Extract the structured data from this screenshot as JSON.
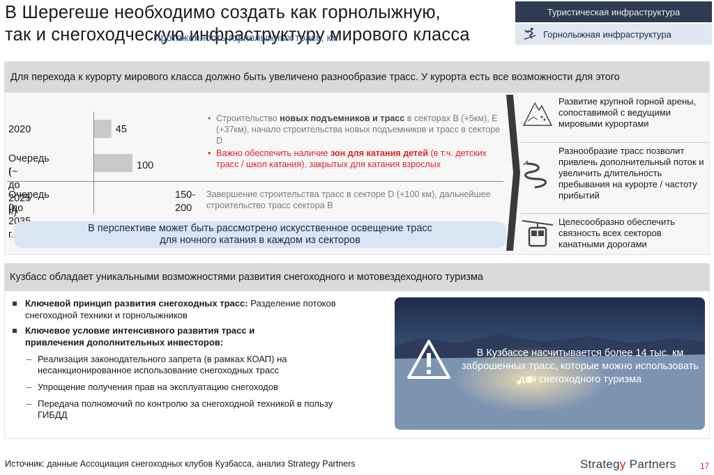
{
  "title": {
    "line1": "В Шерегеше необходимо создать как горнолыжную,",
    "line2": "так и снегоходческую инфраструктуру мирового класса"
  },
  "category": {
    "top": "Туристическая инфраструктура",
    "sub": "Горнолыжная инфраструктура",
    "sub_icon": "skier-icon"
  },
  "panel1": {
    "header": "Для перехода к курорту мирового класса должно быть увеличено разнообразие трасс. У курорта есть все возможности для этого",
    "chart_title": "Протяженность горнолыжных трасс,",
    "chart_unit": " км",
    "bullets_top": [
      {
        "pre": "Строительство ",
        "bold": "новых подъемников и трасс",
        "post": " в секторах В (+5км), Е (+37км), начало строительства новых подъемников и трасс в секторе D",
        "red": false
      },
      {
        "pre": "Важно обеспечить наличие ",
        "bold": "зон для катания детей",
        "post": " (в т.ч. детских трасс / школ катания), закрытых для катания взрослых",
        "red": true
      }
    ],
    "bullet_bottom": "Завершение строительства трасс в секторе D (+100 км), дальнейшее строительство трасс сектора В",
    "perspective": {
      "line1": "В перспективе может быть рассмотрено искусственное освещение трасс",
      "line2": "для ночного катания в каждом из секторов"
    },
    "right_items": [
      {
        "icon": "mountain-icon",
        "text": "Развитие крупной горной арены, сопоставимой с ведущими мировыми курортами"
      },
      {
        "icon": "winding-trail-icon",
        "text": "Разнообразие трасс позволит привлечь дополнительный поток и увеличить длительность пребывания на курорте / частоту прибытий"
      },
      {
        "icon": "cable-car-icon",
        "text": "Целесообразно обеспечить связность всех секторов канатными дорогами"
      }
    ]
  },
  "chart_data": {
    "type": "bar",
    "orientation": "horizontal",
    "title": "Протяженность горнолыжных трасс, км",
    "categories": [
      "2020",
      "Очередь I (~ до 2025 г.)",
      "Очередь II (до 2035 г.)"
    ],
    "category_lines": [
      [
        "2020"
      ],
      [
        "Очередь I",
        "(~ до 2025 г.)"
      ],
      [
        "Очередь II",
        "(до 2035 г.)"
      ]
    ],
    "values": [
      45,
      100,
      200
    ],
    "value_labels": [
      [
        "45"
      ],
      [
        "100"
      ],
      [
        "150-",
        "200"
      ]
    ],
    "xlim": [
      0,
      200
    ],
    "color": "#c9c9c9",
    "grid": false,
    "legend": "none"
  },
  "panel2": {
    "header": "Кузбасс обладает уникальными возможностями развития снегоходного и мотовездеходного туризма",
    "key1_bold": "Ключевой принцип развития снегоходных трасс:",
    "key1_rest": " Разделение потоков снегоходной техники и горнолыжников",
    "key2_bold": "Ключевое условие интенсивного развития трасс и привлечения дополнительных инвесторов:",
    "dashes": [
      "Реализация законодательного запрета (в рамках КОАП) на несанкционированное использование снегоходных трасс",
      "Упрощение получения прав на эксплуатацию снегоходов",
      "Передача полномочий по контролю за снегоходной техникой в пользу ГИБДД"
    ],
    "photo_text": "В Кузбассе насчитывается более 14 тыс. км заброшенных трасс, которые можно использовать для снегоходного туризма",
    "photo_icon": "warning-icon"
  },
  "footer": {
    "source": "Источник: данные Ассоциация снегоходных клубов Кузбасса, анализ Strategy Partners",
    "brand_pre": "Strateg",
    "brand_y": "y",
    "brand_post": " Partners",
    "page": "17"
  },
  "colors": {
    "accent_red": "#e31e24",
    "navy": "#2f3b52",
    "header_gray": "#d9dadc",
    "chart_title_blue": "#3d5a8c",
    "perspective_bg": "#d9e5f2"
  }
}
